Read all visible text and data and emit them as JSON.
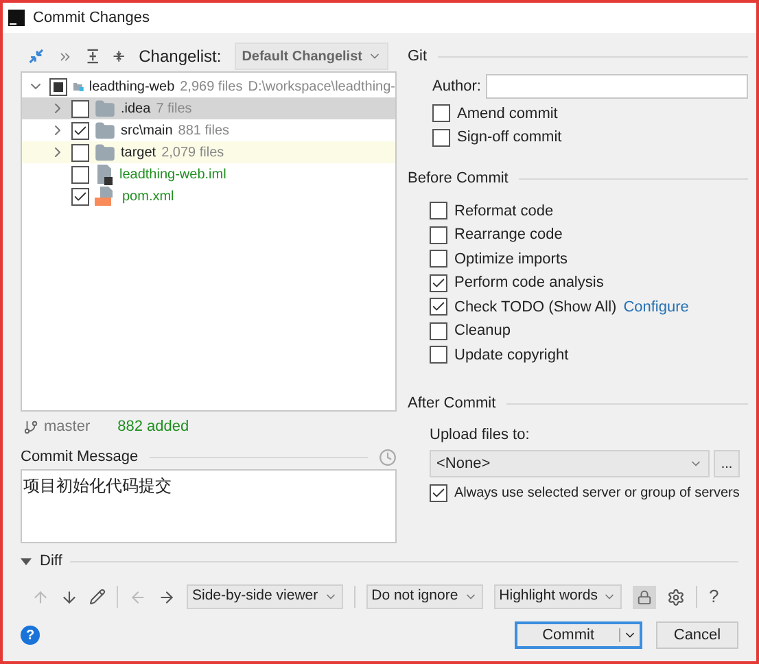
{
  "window": {
    "title": "Commit Changes"
  },
  "toolbar": {
    "changelist_label": "Changelist:",
    "changelist_value": "Default Changelist"
  },
  "tree": [
    {
      "name": "leadthing-web",
      "info": "2,969 files",
      "path": "D:\\workspace\\leadthing-",
      "kind": "module",
      "checked": true,
      "partial": true,
      "expanded": true,
      "selected": false,
      "ignored": false,
      "added": false,
      "children": [
        {
          "name": ".idea",
          "info": "7 files",
          "kind": "folder",
          "checked": false,
          "partial": false,
          "expanded": false,
          "selected": true,
          "ignored": false,
          "added": false
        },
        {
          "name": "src\\main",
          "info": "881 files",
          "kind": "folder",
          "checked": true,
          "partial": false,
          "expanded": false,
          "selected": false,
          "ignored": false,
          "added": false
        },
        {
          "name": "target",
          "info": "2,079 files",
          "kind": "folder",
          "checked": false,
          "partial": false,
          "expanded": false,
          "selected": false,
          "ignored": true,
          "added": false
        },
        {
          "name": "leadthing-web.iml",
          "kind": "iml",
          "checked": false,
          "partial": false,
          "selected": false,
          "ignored": false,
          "added": true
        },
        {
          "name": "pom.xml",
          "kind": "xml",
          "checked": true,
          "partial": false,
          "selected": false,
          "ignored": false,
          "added": true
        }
      ]
    }
  ],
  "status": {
    "branch": "master",
    "summary": "882 added"
  },
  "commit_message": {
    "label": "Commit Message",
    "value": "项目初始化代码提交"
  },
  "git": {
    "title": "Git",
    "author_label": "Author:",
    "options": [
      {
        "label": "Amend commit",
        "checked": false
      },
      {
        "label": "Sign-off commit",
        "checked": false
      }
    ]
  },
  "before_commit": {
    "title": "Before Commit",
    "options": [
      {
        "label": "Reformat code",
        "checked": false
      },
      {
        "label": "Rearrange code",
        "checked": false
      },
      {
        "label": "Optimize imports",
        "checked": false
      },
      {
        "label": "Perform code analysis",
        "checked": true
      },
      {
        "label": "Check TODO (Show All)",
        "checked": true,
        "link": "Configure"
      },
      {
        "label": "Cleanup",
        "checked": false
      },
      {
        "label": "Update copyright",
        "checked": false
      }
    ]
  },
  "after_commit": {
    "title": "After Commit",
    "upload_label": "Upload files to:",
    "server": "<None>",
    "browse": "...",
    "always": {
      "label": "Always use selected server or group of servers",
      "checked": true
    }
  },
  "diff": {
    "title": "Diff",
    "expanded": true,
    "viewer": "Side-by-side viewer",
    "whitespace": "Do not ignore",
    "highlight": "Highlight words",
    "help": "?"
  },
  "buttons": {
    "help": "?",
    "commit": "Commit",
    "cancel": "Cancel"
  }
}
